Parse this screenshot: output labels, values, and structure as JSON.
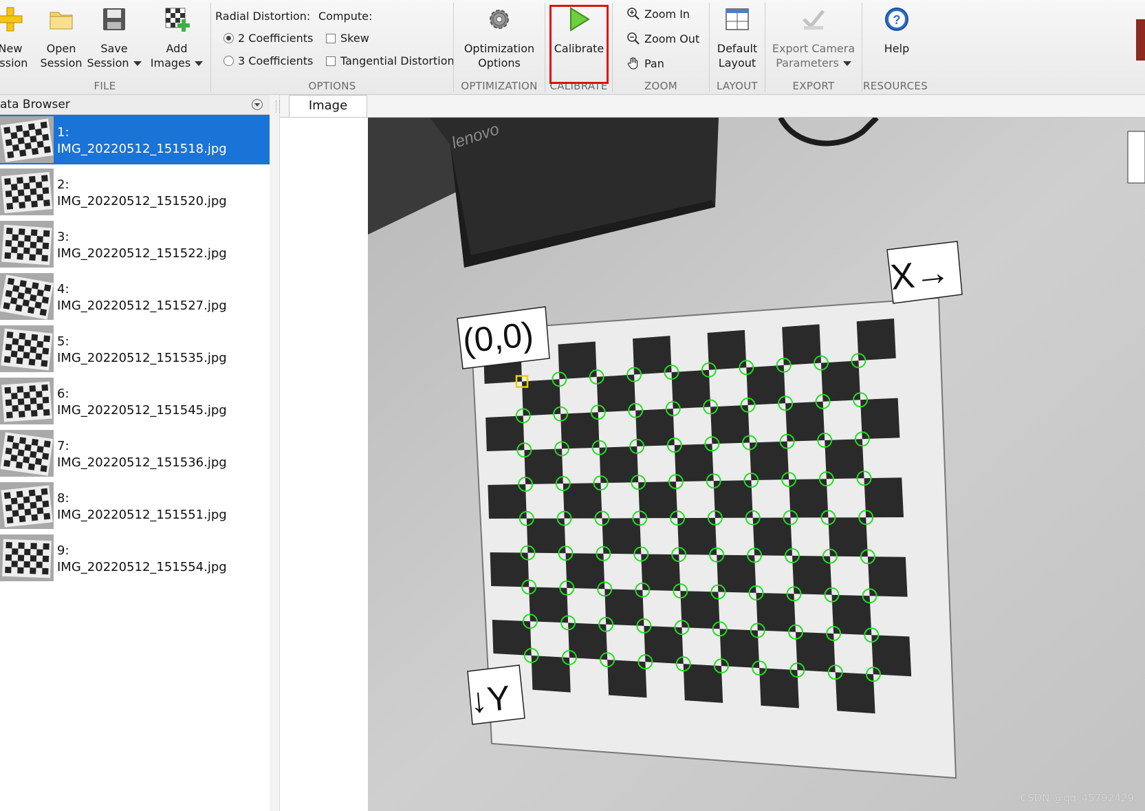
{
  "toolstrip": {
    "file": {
      "new_line1": "New",
      "new_line2": "ession",
      "open_line1": "Open",
      "open_line2": "Session",
      "save_line1": "Save",
      "save_line2": "Session",
      "add_line1": "Add",
      "add_line2": "Images",
      "section": "FILE"
    },
    "options": {
      "radial_label": "Radial Distortion:",
      "compute_label": "Compute:",
      "radial_2": "2 Coefficients",
      "radial_3": "3 Coefficients",
      "skew": "Skew",
      "tangential": "Tangential Distortion",
      "section": "OPTIONS"
    },
    "optimization": {
      "line1": "Optimization",
      "line2": "Options",
      "section": "OPTIMIZATION"
    },
    "calibrate": {
      "label": "Calibrate",
      "section": "CALIBRATE"
    },
    "zoom": {
      "zoom_in": "Zoom In",
      "zoom_out": "Zoom Out",
      "pan": "Pan",
      "section": "ZOOM"
    },
    "layout": {
      "line1": "Default",
      "line2": "Layout",
      "section": "LAYOUT"
    },
    "export": {
      "line1": "Export Camera",
      "line2": "Parameters",
      "section": "EXPORT"
    },
    "resources": {
      "help": "Help",
      "section": "RESOURCES"
    }
  },
  "browser": {
    "title": "ata Browser",
    "items": [
      {
        "index": "1:",
        "name": "IMG_20220512_151518.jpg"
      },
      {
        "index": "2:",
        "name": "IMG_20220512_151520.jpg"
      },
      {
        "index": "3:",
        "name": "IMG_20220512_151522.jpg"
      },
      {
        "index": "4:",
        "name": "IMG_20220512_151527.jpg"
      },
      {
        "index": "5:",
        "name": "IMG_20220512_151535.jpg"
      },
      {
        "index": "6:",
        "name": "IMG_20220512_151545.jpg"
      },
      {
        "index": "7:",
        "name": "IMG_20220512_151536.jpg"
      },
      {
        "index": "8:",
        "name": "IMG_20220512_151551.jpg"
      },
      {
        "index": "9:",
        "name": "IMG_20220512_151554.jpg"
      }
    ]
  },
  "image_tab": {
    "label": "Image"
  },
  "photo": {
    "brand": "lenovo",
    "origin_label": "(0,0)",
    "x_label": "X→",
    "y_label": "↓Y"
  },
  "watermark": "CSDN @qq_45792429",
  "colors": {
    "selection": "#1a73d6",
    "highlight": "#e01010",
    "detected_point": "#22dd22",
    "origin_marker": "#e8d000"
  }
}
